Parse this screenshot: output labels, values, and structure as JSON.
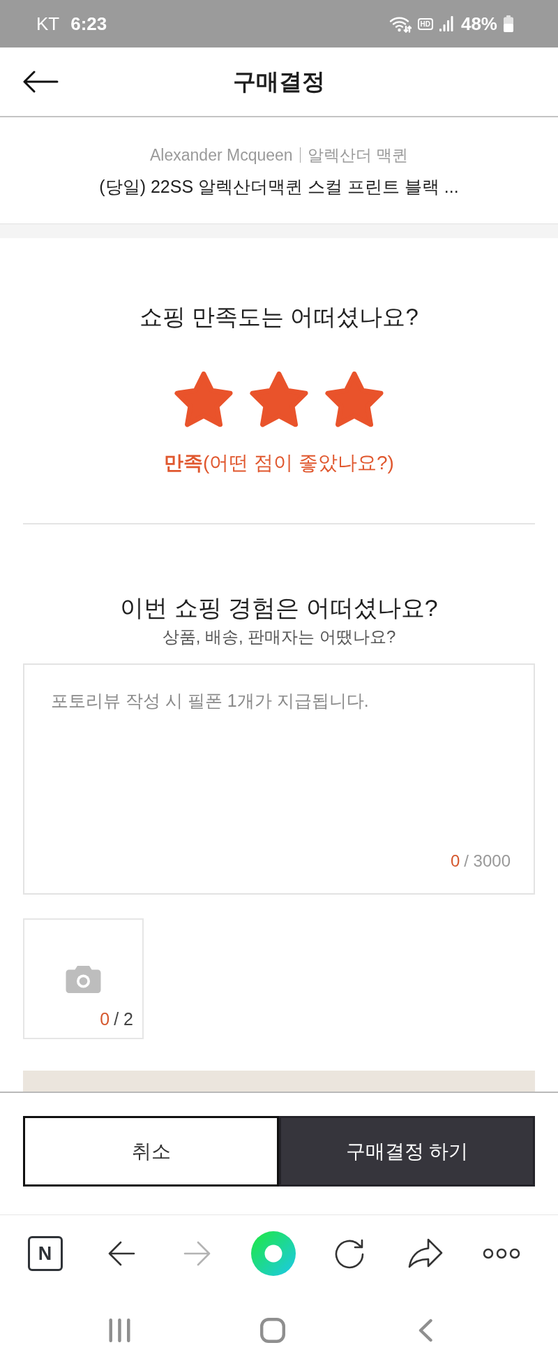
{
  "status_bar": {
    "carrier": "KT",
    "time": "6:23",
    "hd_label": "HD",
    "battery": "48%"
  },
  "header": {
    "title": "구매결정"
  },
  "product": {
    "brand": "Alexander Mcqueen",
    "brand_local": "알렉산더 맥퀸",
    "name": "(당일) 22SS 알렉산더맥퀸 스컬 프린트 블랙 ..."
  },
  "rating": {
    "question": "쇼핑 만족도는 어떠셨나요?",
    "stars": 3,
    "label": "**만족**(어떤 점이 좋았나요?)"
  },
  "review": {
    "question": "이번 쇼핑 경험은 어떠셨나요?",
    "subtitle": "상품, 배송, 판매자는 어땠나요?",
    "placeholder": "포토리뷰 작성 시 필폰 1개가 지급됩니다.",
    "count": "0",
    "limit": "/ 3000"
  },
  "photos": {
    "count": "0",
    "limit": "/ 2"
  },
  "actions": [
    {
      "kind": "secondary",
      "label": "취소"
    },
    {
      "kind": "primary",
      "label": "구매결정 하기"
    }
  ],
  "browser_toolbar": {
    "logo": "N",
    "back_disabled": false,
    "forward_disabled": true
  }
}
